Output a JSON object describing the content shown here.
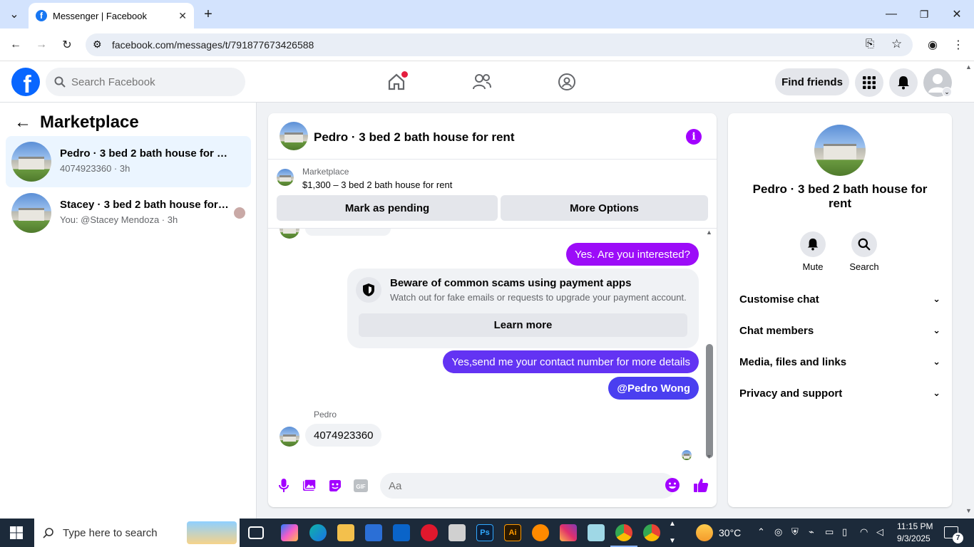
{
  "browser": {
    "tab_title": "Messenger | Facebook",
    "url": "facebook.com/messages/t/791877673426588"
  },
  "fb_header": {
    "search_placeholder": "Search Facebook",
    "find_friends": "Find friends"
  },
  "sidebar": {
    "title": "Marketplace",
    "conversations": [
      {
        "name": "Pedro · 3 bed 2 bath house for rent",
        "snippet": "4074923360 · 3h"
      },
      {
        "name": "Stacey · 3 bed 2 bath house for r...",
        "snippet": "You: @Stacey Mendoza · 3h"
      }
    ]
  },
  "chat": {
    "title": "Pedro · 3 bed 2 bath house for rent",
    "listing": {
      "label": "Marketplace",
      "detail": "$1,300 – 3 bed 2 bath house for rent",
      "pending_button": "Mark as pending",
      "options_button": "More Options"
    },
    "messages": {
      "m1": "Yes. Are you interested?",
      "m2": "Yes,send me your contact number for more details",
      "m3": "@Pedro Wong",
      "sender": "Pedro",
      "m4": "4074923360"
    },
    "scam_warning": {
      "heading": "Beware of common scams using payment apps",
      "body": "Watch out for fake emails or requests to upgrade your payment account.",
      "button": "Learn more"
    },
    "composer_placeholder": "Aa",
    "colors": {
      "accent": "#a200ff",
      "bubble_purple": "#9c0cf8",
      "bubble_blue": "#4a3ff0"
    }
  },
  "right_panel": {
    "name": "Pedro · 3 bed 2 bath house for rent",
    "mute": "Mute",
    "search": "Search",
    "sections": [
      "Customise chat",
      "Chat members",
      "Media, files and links",
      "Privacy and support"
    ]
  },
  "taskbar": {
    "search_placeholder": "Type here to search",
    "temperature": "30°C",
    "time": "11:15 PM",
    "date": "9/3/2025",
    "notifications": "7"
  }
}
